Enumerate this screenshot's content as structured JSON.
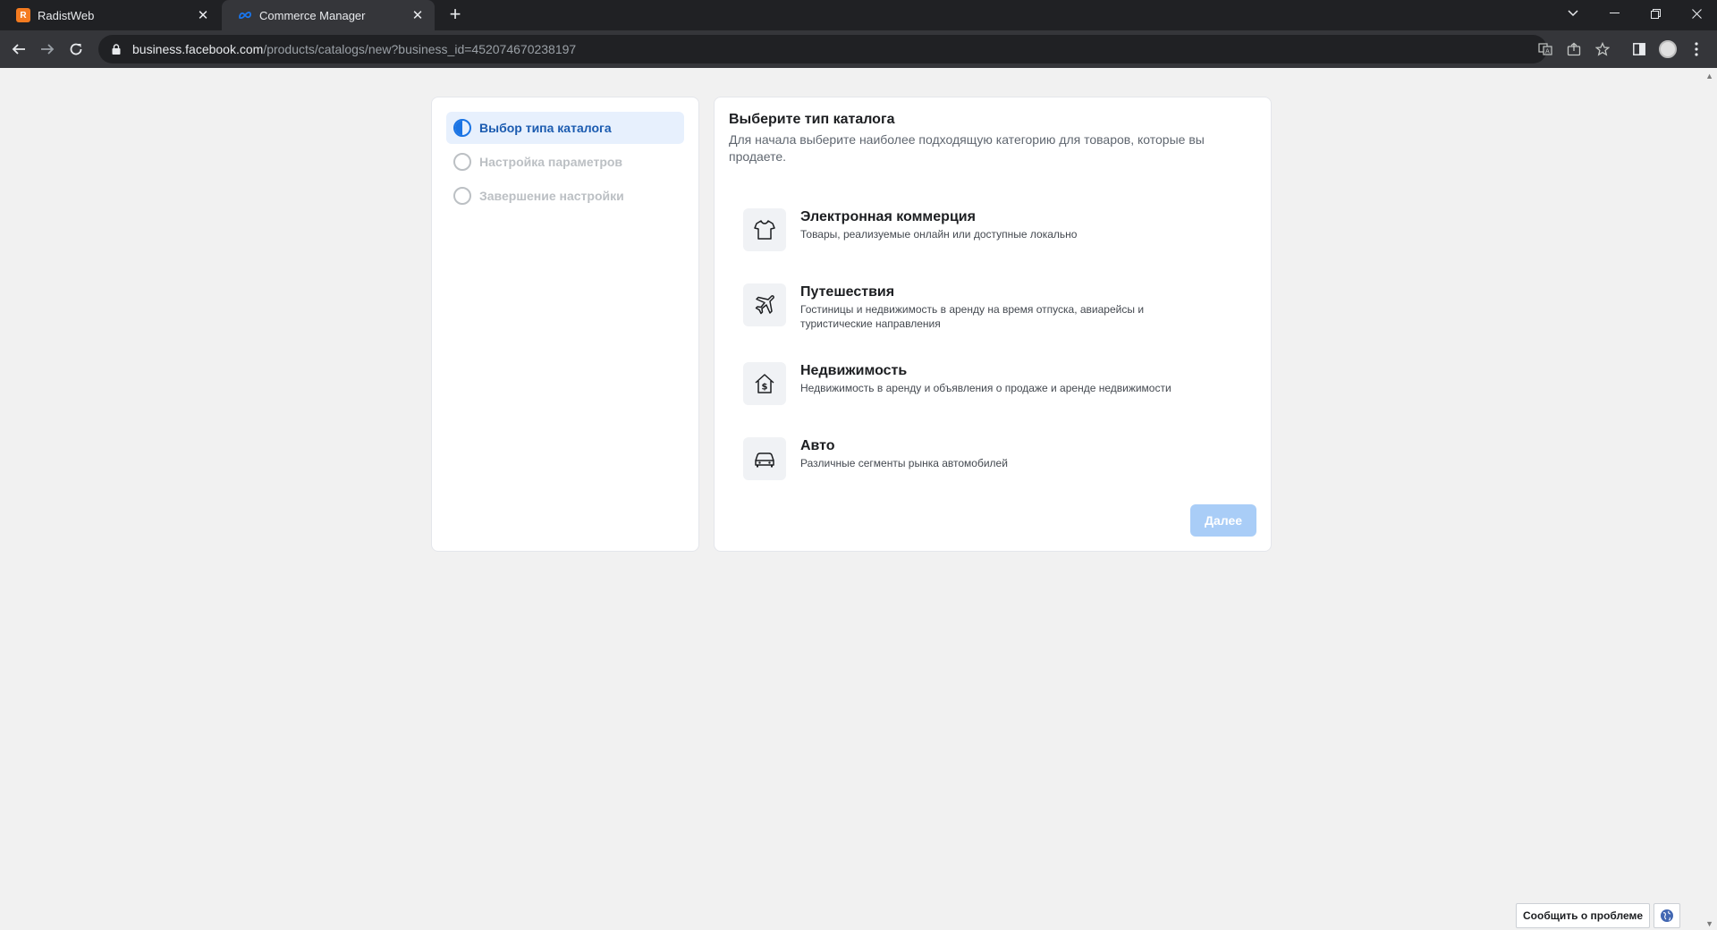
{
  "browser": {
    "tabs": [
      {
        "title": "RadistWeb",
        "favicon": "radist-favicon"
      },
      {
        "title": "Commerce Manager",
        "favicon": "meta-favicon"
      }
    ],
    "url": {
      "host": "business.facebook.com",
      "path": "/products/catalogs/new?business_id=452074670238197"
    }
  },
  "steps": [
    {
      "label": "Выбор типа каталога",
      "state": "active"
    },
    {
      "label": "Настройка параметров",
      "state": "pending"
    },
    {
      "label": "Завершение настройки",
      "state": "pending"
    }
  ],
  "main": {
    "title": "Выберите тип каталога",
    "subtitle": "Для начала выберите наиболее подходящую категорию для товаров, которые вы продаете.",
    "options": [
      {
        "title": "Электронная коммерция",
        "description": "Товары, реализуемые онлайн или доступные локально",
        "icon": "tshirt-icon"
      },
      {
        "title": "Путешествия",
        "description": "Гостиницы и недвижимость в аренду на время отпуска, авиарейсы и туристические направления",
        "icon": "airplane-icon"
      },
      {
        "title": "Недвижимость",
        "description": "Недвижимость в аренду и объявления о продаже и аренде недвижимости",
        "icon": "house-dollar-icon"
      },
      {
        "title": "Авто",
        "description": "Различные сегменты рынка автомобилей",
        "icon": "car-icon"
      }
    ],
    "next_label": "Далее"
  },
  "footer": {
    "report_label": "Сообщить о проблеме"
  },
  "colors": {
    "accent": "#1b74e4",
    "active_step_bg": "#e7f0fd",
    "disabled_button": "#a9cdf7",
    "page_bg": "#f1f1f1"
  }
}
